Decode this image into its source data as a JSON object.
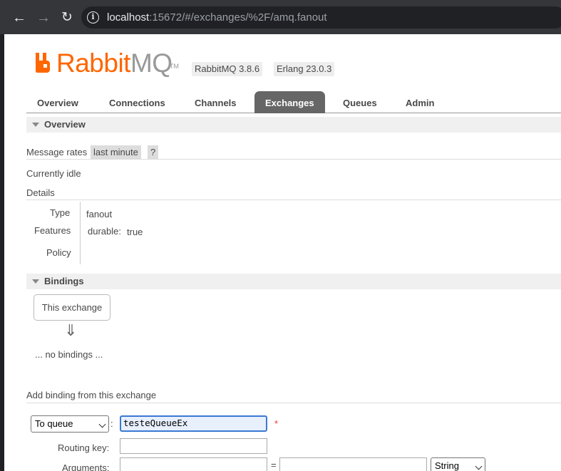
{
  "browser": {
    "url_host": "localhost",
    "url_rest": ":15672/#/exchanges/%2F/amq.fanout"
  },
  "header": {
    "logo_rabbit": "Rabbit",
    "logo_mq": "MQ",
    "logo_tm": "TM",
    "version": "RabbitMQ 3.8.6",
    "erlang": "Erlang 23.0.3"
  },
  "tabs": [
    {
      "label": "Overview"
    },
    {
      "label": "Connections"
    },
    {
      "label": "Channels"
    },
    {
      "label": "Exchanges",
      "active": true
    },
    {
      "label": "Queues"
    },
    {
      "label": "Admin"
    }
  ],
  "overview": {
    "heading": "Overview",
    "message_rates_label": "Message rates",
    "rate_range": "last minute",
    "help": "?",
    "status": "Currently idle",
    "details_label": "Details",
    "type_label": "Type",
    "type_value": "fanout",
    "features_label": "Features",
    "durable_key": "durable:",
    "durable_value": "true",
    "policy_label": "Policy"
  },
  "bindings": {
    "heading": "Bindings",
    "this_exchange": "This exchange",
    "arrow": "⇓",
    "no_bindings": "... no bindings ..."
  },
  "add_binding": {
    "title": "Add binding from this exchange",
    "destination_type": "To queue",
    "colon": ":",
    "destination_value": "testeQueueEx",
    "required_mark": "*",
    "routing_key_label": "Routing key:",
    "routing_key_value": "",
    "arguments_label": "Arguments:",
    "equals": "=",
    "arg_type": "String"
  },
  "colors": {
    "accent": "#ff6600",
    "active_tab": "#666666",
    "focus": "#3b79d4"
  }
}
